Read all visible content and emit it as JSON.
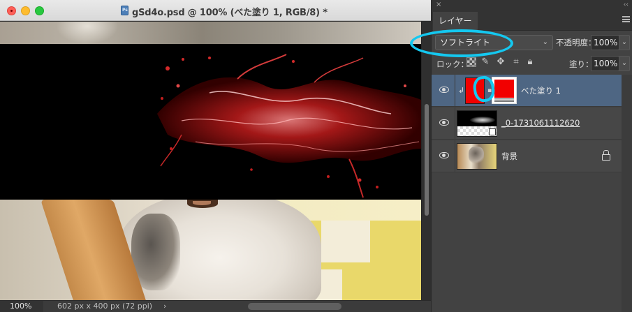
{
  "document": {
    "title": "gSd4o.psd @ 100% (べた塗り 1, RGB/8) *",
    "zoom": "100%",
    "doc_info": "602 px x 400 px (72 ppi)",
    "status_arrow": "›"
  },
  "panel": {
    "tab": "レイヤー",
    "blend_mode": "ソフトライト",
    "opacity_label": "不透明度：",
    "opacity_value": "100%",
    "lock_label": "ロック：",
    "fill_label": "塗り：",
    "fill_value": "100%",
    "layers": [
      {
        "name": "べた塗り 1",
        "selected": true,
        "visible": true,
        "clipped": true
      },
      {
        "name": "_0-1731061112620",
        "selected": false,
        "visible": true
      },
      {
        "name": "背景",
        "selected": false,
        "visible": true,
        "locked": true
      }
    ]
  },
  "icons": {
    "close": "close-icon",
    "minimize": "minimize-icon",
    "maximize": "maximize-icon",
    "panel_menu": "menu-icon",
    "visibility": "eye-icon",
    "clip": "clip-arrow-icon",
    "lock": "lock-icon"
  },
  "colors": {
    "fill_color": "#f20000",
    "selected_layer": "#4e6683",
    "annotation": "#14c8f0"
  }
}
